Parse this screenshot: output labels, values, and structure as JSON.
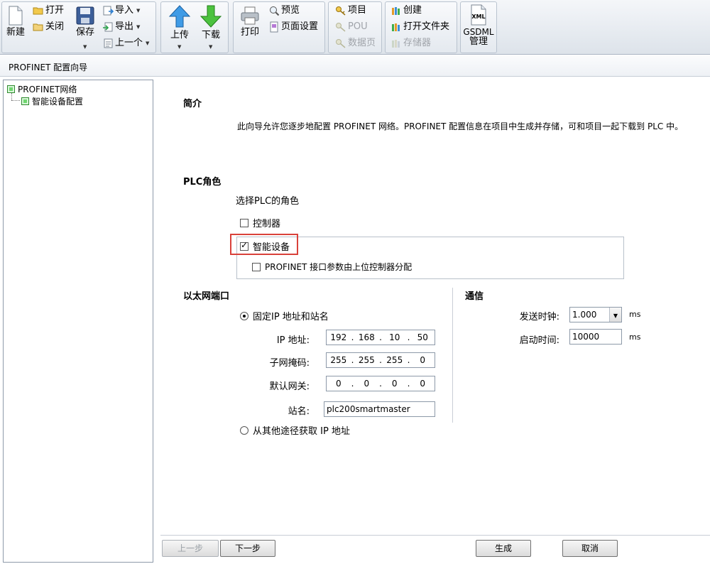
{
  "ribbon": {
    "file_new": "新建",
    "file_open": "打开",
    "file_close": "关闭",
    "file_save": "保存",
    "file_import": "导入",
    "file_export": "导出",
    "file_previous": "上一个",
    "upload": "上传",
    "download": "下载",
    "print": "打印",
    "preview": "预览",
    "page_setup": "页面设置",
    "project": "项目",
    "pou": "POU",
    "data_page": "数据页",
    "create": "创建",
    "open_folder": "打开文件夹",
    "memory": "存储器",
    "gsdml_label": "GSDML",
    "gsdml_manage": "管理",
    "xml_badge": "XML"
  },
  "window_title": "PROFINET 配置向导",
  "tree": {
    "root": "PROFINET网络",
    "child": "智能设备配置"
  },
  "intro": {
    "heading": "简介",
    "text": "此向导允许您逐步地配置 PROFINET 网络。PROFINET 配置信息在项目中生成并存储，可和项目一起下载到 PLC 中。"
  },
  "plc_role": {
    "heading": "PLC角色",
    "prompt": "选择PLC的角色",
    "controller": "控制器",
    "controller_checked": false,
    "intelligent_device": "智能设备",
    "intelligent_device_checked": true,
    "param_by_upper": "PROFINET 接口参数由上位控制器分配",
    "param_by_upper_checked": false
  },
  "ethernet": {
    "heading": "以太网端口",
    "fixed_ip": "固定IP 地址和站名",
    "fixed_ip_selected": true,
    "ip_label": "IP 地址:",
    "ip": [
      "192",
      "168",
      "10",
      "50"
    ],
    "mask_label": "子网掩码:",
    "mask": [
      "255",
      "255",
      "255",
      "0"
    ],
    "gateway_label": "默认网关:",
    "gateway": [
      "0",
      "0",
      "0",
      "0"
    ],
    "station_label": "站名:",
    "station": "plc200smartmaster",
    "other_ip": "从其他途径获取 IP 地址"
  },
  "comm": {
    "heading": "通信",
    "send_clock_label": "发送时钟:",
    "send_clock": "1.000",
    "send_clock_unit": "ms",
    "startup_label": "启动时间:",
    "startup": "10000",
    "startup_unit": "ms"
  },
  "buttons": {
    "prev": "上一步",
    "next": "下一步",
    "generate": "生成",
    "cancel": "取消"
  },
  "colors": {
    "highlight": "#d9413a",
    "tree_icon": "#6fd66f"
  }
}
